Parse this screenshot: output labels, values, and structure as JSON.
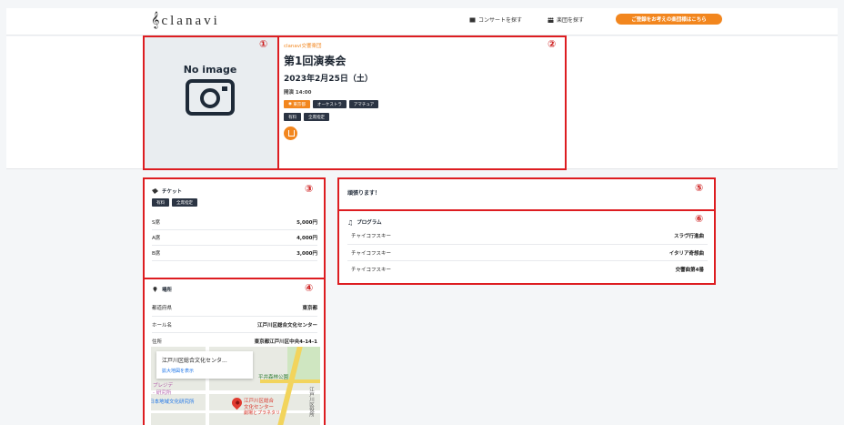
{
  "header": {
    "logo_text": "clanavi",
    "nav_concerts": "コンサートを探す",
    "nav_orchestras": "楽団を探す",
    "cta": "ご登録をお考えの楽団様はこちら"
  },
  "concert": {
    "image_placeholder": "No image",
    "organizer": "clanavi交響楽団",
    "title": "第1回演奏会",
    "date": "2023年2月25日（土）",
    "time": "開演 14:00",
    "tags_row1": [
      "東京都",
      "オーケストラ",
      "アマチュア"
    ],
    "tags_row2": [
      "有料",
      "全席指定"
    ]
  },
  "ticket": {
    "heading": "チケット",
    "tags": [
      "有料",
      "全席指定"
    ],
    "rows": [
      {
        "seat": "S席",
        "price": "5,000円"
      },
      {
        "seat": "A席",
        "price": "4,000円"
      },
      {
        "seat": "B席",
        "price": "3,000円"
      }
    ]
  },
  "place": {
    "heading": "場所",
    "rows": [
      {
        "label": "都道府県",
        "value": "東京都"
      },
      {
        "label": "ホール名",
        "value": "江戸川区総合文化センター"
      },
      {
        "label": "住所",
        "value": "東京都江戸川区中央4-14-1"
      }
    ]
  },
  "map": {
    "place_name": "江戸川区総合文化センタ...",
    "enlarge_link": "拡大地図を表示",
    "label_park": "平井森林公園",
    "label_left": "プレジデ",
    "label_left2": "- 研究所",
    "label_lab": "日本地域文化研究所",
    "label_venue1": "江戸川区総合",
    "label_venue2": "文化センター",
    "label_venue3": "劇場とプラネタリ",
    "label_river": "江戸川区役所"
  },
  "message": {
    "text": "頑張ります！"
  },
  "program": {
    "heading": "プログラム",
    "rows": [
      {
        "composer": "チャイコフスキー",
        "piece": "スラヴ行進曲"
      },
      {
        "composer": "チャイコフスキー",
        "piece": "イタリア奇想曲"
      },
      {
        "composer": "チャイコフスキー",
        "piece": "交響曲第4番"
      }
    ]
  },
  "annotations": [
    "①",
    "②",
    "③",
    "④",
    "⑤",
    "⑥"
  ],
  "colors": {
    "accent": "#f2861e",
    "highlight": "#dd1d21",
    "tag_dark": "#2b3443"
  }
}
